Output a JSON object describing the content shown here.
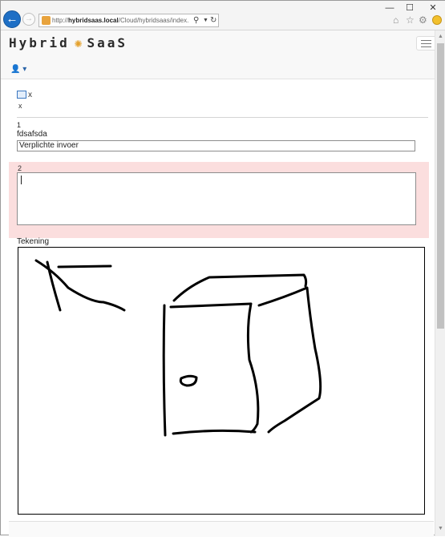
{
  "browser": {
    "url_prefix": "http://",
    "url_host": "hybridsaas.local",
    "url_path": "/Cloud/hybridsaas/index.asp",
    "controls": {
      "minimize": "—",
      "maximize": "☐",
      "close": "✕"
    },
    "icons": [
      "back-icon",
      "forward-icon",
      "search-icon",
      "refresh-icon",
      "home-icon",
      "star-icon",
      "gear-icon",
      "smiley-icon"
    ]
  },
  "header": {
    "logo_left": "Hybrid",
    "logo_right": "SaaS",
    "user_icon": "👤",
    "user_caret": "▾"
  },
  "breadcrumb": {
    "title": "x",
    "sub": "x"
  },
  "form": {
    "field1": {
      "number": "1",
      "label": "fdsafsda",
      "value": "Verplichte invoer"
    },
    "field2": {
      "number": "2",
      "value": ""
    },
    "drawing": {
      "label": "Tekening"
    }
  },
  "colors": {
    "accent": "#1e6fc5",
    "required_bg": "#fbdede",
    "logo_mark": "#e4a12c"
  }
}
